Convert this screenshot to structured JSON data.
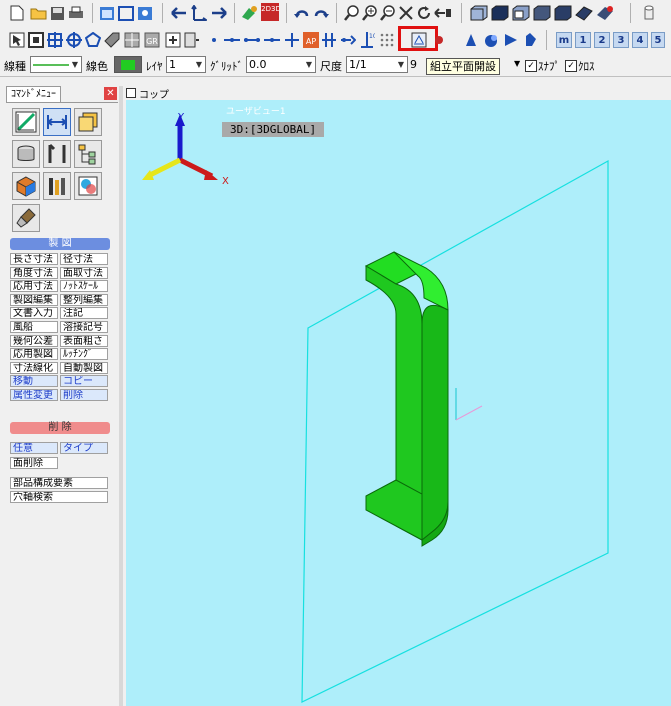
{
  "toolbar_row1": {
    "icons": [
      "new-file-icon",
      "open-folder-icon",
      "save-icon",
      "print-icon",
      "window-icon",
      "rectangle-view-icon",
      "fit-view-icon",
      "move-left-icon",
      "move-transform-icon",
      "move-right-icon",
      "paint-icon",
      "view-2d3d-icon",
      "undo-icon",
      "redo-icon",
      "zoom-icon",
      "zoom-in-icon",
      "zoom-out-icon",
      "zoom-cross-icon",
      "rotate-icon",
      "pan-left-icon",
      "shade-box-1-icon",
      "shade-box-2-icon",
      "shade-box-3-icon",
      "shade-box-4-icon",
      "shade-box-5-icon",
      "shade-box-6-icon",
      "shade-box-7-icon",
      "cylinder-icon"
    ],
    "view_2d3d_text": "2D3D"
  },
  "toolbar_row2": {
    "icons": [
      "select-cursor-icon",
      "box-icon",
      "crosshair-icon",
      "center-icon",
      "polygon-icon",
      "tag-icon",
      "grid-box-icon",
      "grid-box-2-icon",
      "snap-icon",
      "snap-2-icon",
      "dot-icon",
      "line-1-icon",
      "line-2-icon",
      "line-3-icon",
      "plus-icon",
      "ap-icon",
      "column-icon",
      "arrow-snap-icon",
      "pole-icon",
      "grid-dots-icon",
      "assembly-flatten-icon",
      "mini-icon",
      "solid-1-icon",
      "solid-2-icon",
      "solid-3-icon",
      "solid-4-icon"
    ],
    "highlight_color": "#e01010",
    "ap_text": "AP",
    "number_buttons": [
      "m",
      "1",
      "2",
      "3",
      "4",
      "5"
    ]
  },
  "toolbar_row3": {
    "line_type_label": "線種",
    "line_color_label": "線色",
    "line_color_value": "#22cc22",
    "layer_label": "ﾚｲﾔ",
    "layer_value": "1",
    "grid_label": "ｸﾞﾘｯﾄﾞ",
    "grid_value": "0.0",
    "scale_label": "尺度",
    "scale_value": "1/1",
    "scale_extra": "9",
    "tooltip_text": "組立平面開設",
    "snap_label": "ｽﾅｯﾌﾟ",
    "snap_display": "ｽﾅﾌﾟ",
    "cross_label": "ｸﾛｽ"
  },
  "command_menu": {
    "title": "ｺﾏﾝﾄﾞﾒﾆｭｰ",
    "big_icons": [
      "ruler-icon",
      "dimension-icon",
      "layers-icon",
      "part-icon",
      "tools-icon",
      "tree-icon",
      "cube-icon",
      "library-icon",
      "material-icon",
      "brush-icon"
    ],
    "section_drawing": "製 図",
    "commands": [
      [
        "長さ寸法",
        "径寸法"
      ],
      [
        "角度寸法",
        "面取寸法"
      ],
      [
        "応用寸法",
        "ﾉｯﾄｽｹｰﾙ"
      ],
      [
        "製図編集",
        "整列編集"
      ],
      [
        "文書入力",
        "注記"
      ],
      [
        "風船",
        "溶接記号"
      ],
      [
        "幾何公差",
        "表面粗さ"
      ],
      [
        "応用製図",
        "ﾙｯﾁﾝｸﾞ"
      ],
      [
        "寸法線化",
        "自動製図"
      ],
      [
        "移動",
        "コピー"
      ],
      [
        "属性変更",
        "削除"
      ]
    ],
    "section_delete": "削 除",
    "delete_options": [
      "任意",
      "タイプ"
    ],
    "face_delete": "面削除",
    "part_element": "部品構成要素",
    "hole_search": "穴軸検索"
  },
  "viewport": {
    "title": "コップ",
    "user_view_label": "ユーザビュー1",
    "coord_label": "3D:[3DGLOBAL]",
    "axis_y": "Y",
    "axis_x": "X",
    "bg_color": "#aeeefa",
    "plane_color": "#16e0e0",
    "part_color": "#22dd22"
  }
}
